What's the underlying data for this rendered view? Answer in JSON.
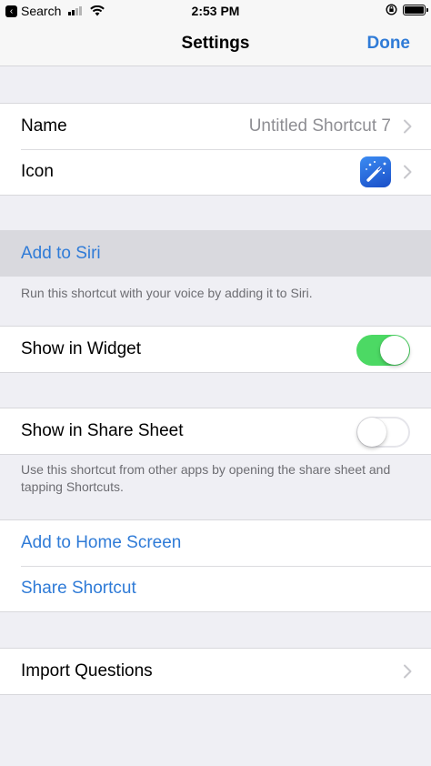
{
  "status_bar": {
    "back_label": "Search",
    "time": "2:53 PM"
  },
  "nav": {
    "title": "Settings",
    "done_label": "Done"
  },
  "info_group": {
    "name_label": "Name",
    "name_value": "Untitled Shortcut 7",
    "icon_label": "Icon"
  },
  "siri": {
    "add_label": "Add to Siri",
    "footer": "Run this shortcut with your voice by adding it to Siri."
  },
  "widget": {
    "label": "Show in Widget",
    "enabled": true
  },
  "share_sheet": {
    "label": "Show in Share Sheet",
    "enabled": false,
    "footer": "Use this shortcut from other apps by opening the share sheet and tapping Shortcuts."
  },
  "actions": {
    "home_screen_label": "Add to Home Screen",
    "share_label": "Share Shortcut"
  },
  "import": {
    "label": "Import Questions"
  },
  "colors": {
    "accent": "#2f7bd7",
    "toggle_on": "#4cd964",
    "background": "#efeff4"
  }
}
